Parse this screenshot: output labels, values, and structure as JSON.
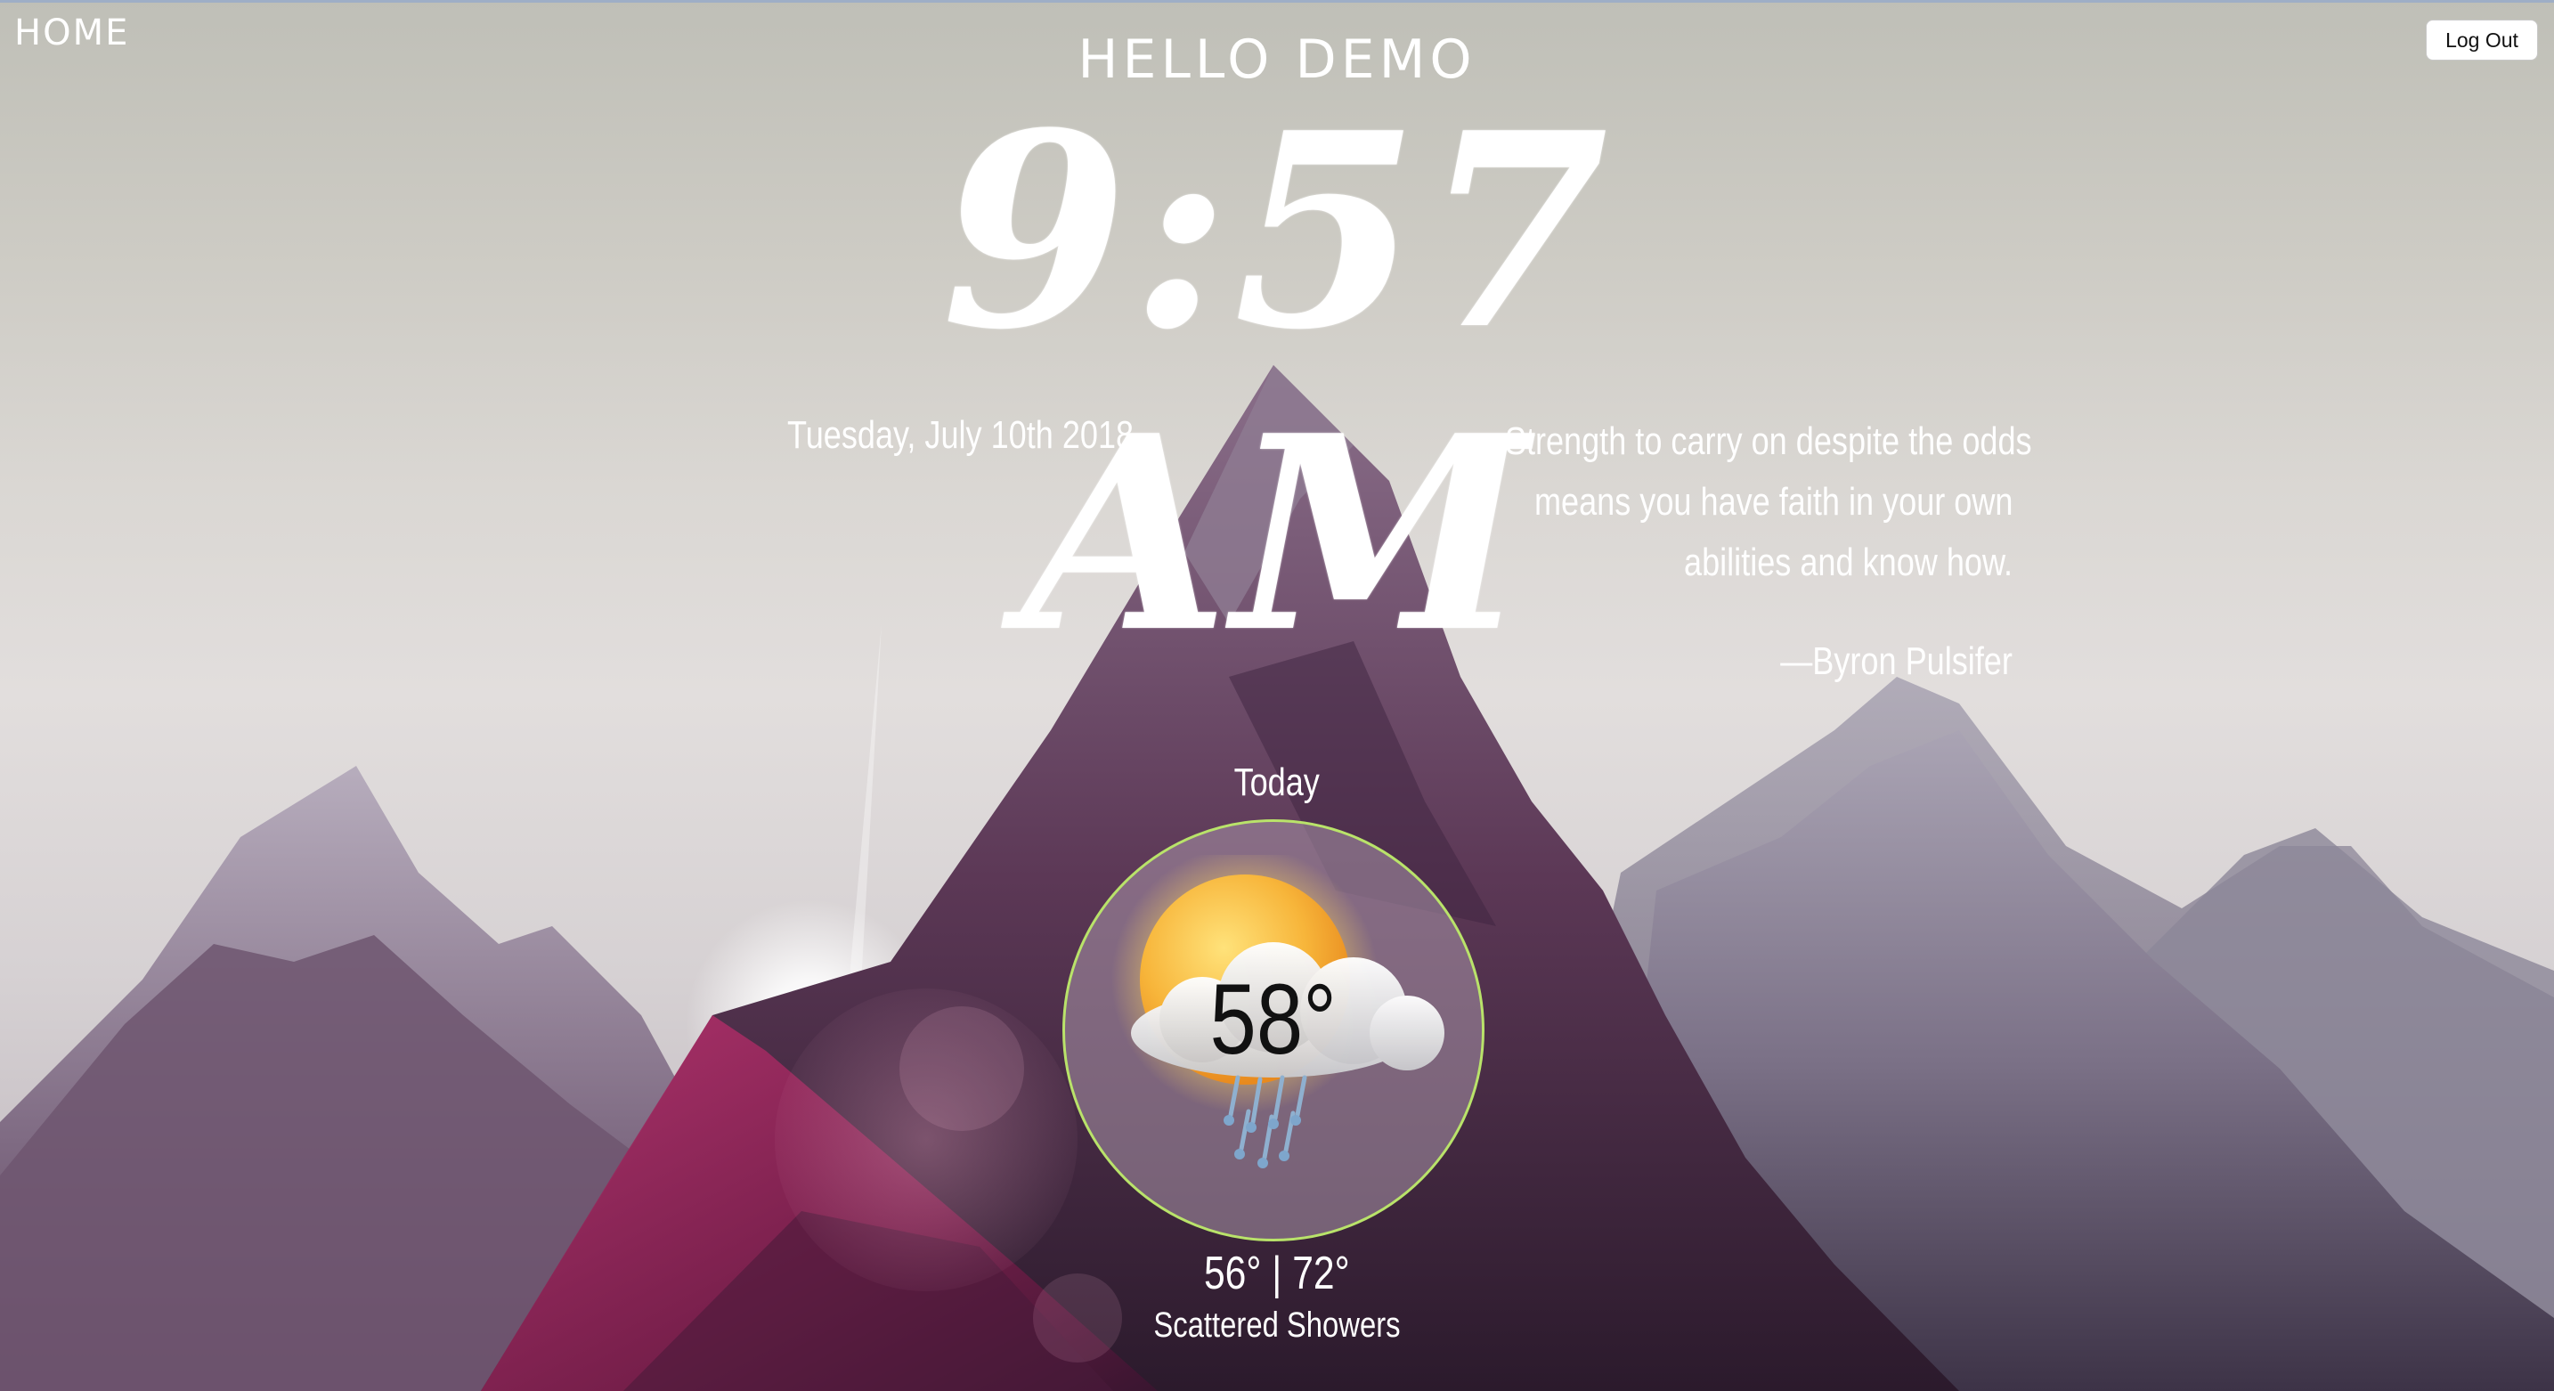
{
  "nav": {
    "home_label": "HOME",
    "logout_label": "Log Out"
  },
  "header": {
    "greeting": "HELLO DEMO",
    "time": "9:57 AM",
    "date": "Tuesday, July 10th 2018"
  },
  "quote": {
    "lines": [
      "Strength to carry on despite the odds",
      "means you have faith in your own",
      "abilities and know how."
    ],
    "author": "—Byron Pulsifer"
  },
  "weather": {
    "day_label": "Today",
    "current_temp": "58°",
    "range": "56° | 72°",
    "condition": "Scattered Showers",
    "icon": "partly-sunny-showers-icon",
    "ring_color": "#b9e36a"
  },
  "theme": {
    "background": "mountain-landscape"
  }
}
